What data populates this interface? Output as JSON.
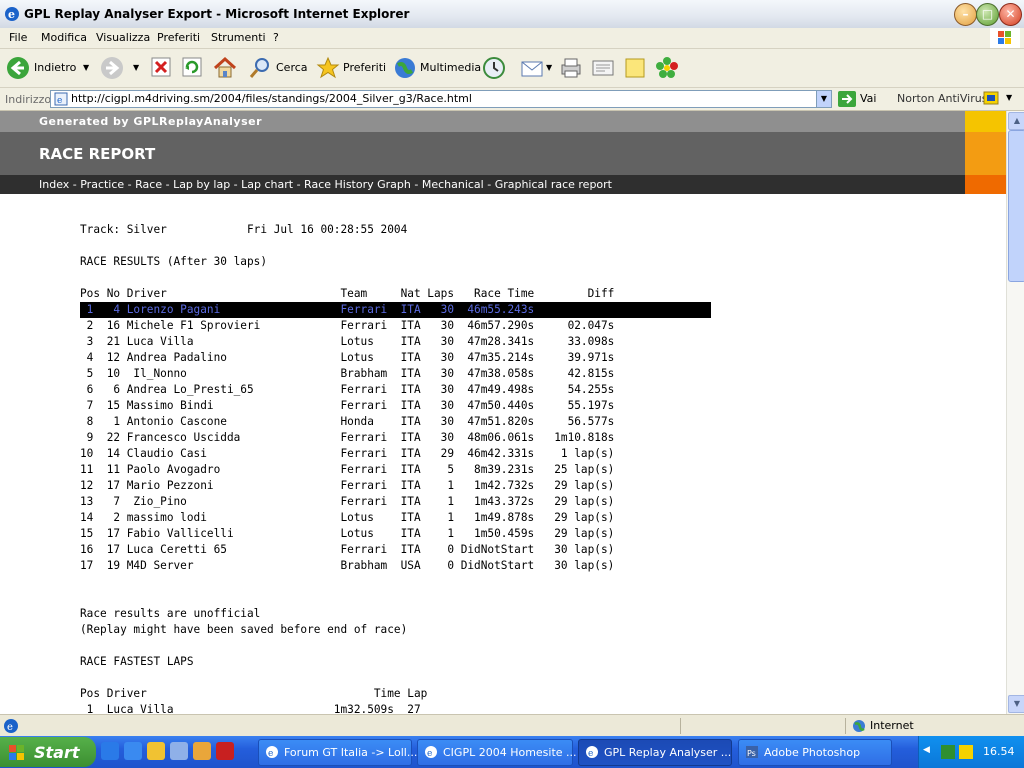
{
  "window": {
    "title": "GPL Replay Analyser Export - Microsoft Internet Explorer",
    "minimize": "–",
    "maximize": "□",
    "close": "✕"
  },
  "menu": [
    "File",
    "Modifica",
    "Visualizza",
    "Preferiti",
    "Strumenti",
    "?"
  ],
  "toolbar": {
    "back": "Indietro",
    "search": "Cerca",
    "favorites": "Preferiti",
    "media": "Multimedia"
  },
  "address": {
    "label": "Indirizzo",
    "url": "http://cigpl.m4driving.sm/2004/files/standings/2004_Silver_g3/Race.html",
    "go": "Vai",
    "norton": "Norton AntiVirus"
  },
  "page": {
    "generated": "Generated by GPLReplayAnalyser",
    "heading": "RACE REPORT",
    "nav": "Index - Practice - Race - Lap by lap - Lap chart - Race History Graph - Mechanical - Graphical race report",
    "track_line": "Track: Silver            Fri Jul 16 00:28:55 2004",
    "results_title": "RACE RESULTS (After 30 laps)",
    "results_header": "Pos No Driver                          Team     Nat Laps   Race Time        Diff",
    "results": [
      " 1   4 Lorenzo Pagani                  Ferrari  ITA   30  46m55.243s            ",
      " 2  16 Michele F1 Sprovieri            Ferrari  ITA   30  46m57.290s     02.047s",
      " 3  21 Luca Villa                      Lotus    ITA   30  47m28.341s     33.098s",
      " 4  12 Andrea Padalino                 Lotus    ITA   30  47m35.214s     39.971s",
      " 5  10  Il_Nonno                       Brabham  ITA   30  47m38.058s     42.815s",
      " 6   6 Andrea Lo_Presti_65             Ferrari  ITA   30  47m49.498s     54.255s",
      " 7  15 Massimo Bindi                   Ferrari  ITA   30  47m50.440s     55.197s",
      " 8   1 Antonio Cascone                 Honda    ITA   30  47m51.820s     56.577s",
      " 9  22 Francesco Uscidda               Ferrari  ITA   30  48m06.061s   1m10.818s",
      "10  14 Claudio Casi                    Ferrari  ITA   29  46m42.331s    1 lap(s)",
      "11  11 Paolo Avogadro                  Ferrari  ITA    5   8m39.231s   25 lap(s)",
      "12  17 Mario Pezzoni                   Ferrari  ITA    1   1m42.732s   29 lap(s)",
      "13   7  Zio_Pino                       Ferrari  ITA    1   1m43.372s   29 lap(s)",
      "14   2 massimo lodi                    Lotus    ITA    1   1m49.878s   29 lap(s)",
      "15  17 Fabio Vallicelli                Lotus    ITA    1   1m50.459s   29 lap(s)",
      "16  17 Luca Ceretti 65                 Ferrari  ITA    0 DidNotStart   30 lap(s)",
      "17  19 M4D Server                      Brabham  USA    0 DidNotStart   30 lap(s)"
    ],
    "note1": "Race results are unofficial",
    "note2": "(Replay might have been saved before end of race)",
    "fastest_title": "RACE FASTEST LAPS",
    "fastest_header": "Pos Driver                                  Time Lap",
    "fastest_first": " 1  Luca Villa                        1m32.509s  27"
  },
  "status": {
    "zone": "Internet"
  },
  "taskbar": {
    "start": "Start",
    "tasks": [
      "Forum GT Italia -> Loll...",
      "CIGPL 2004 Homesite ...",
      "GPL Replay Analyser ...",
      "Adobe Photoshop"
    ],
    "clock": "16.54"
  }
}
